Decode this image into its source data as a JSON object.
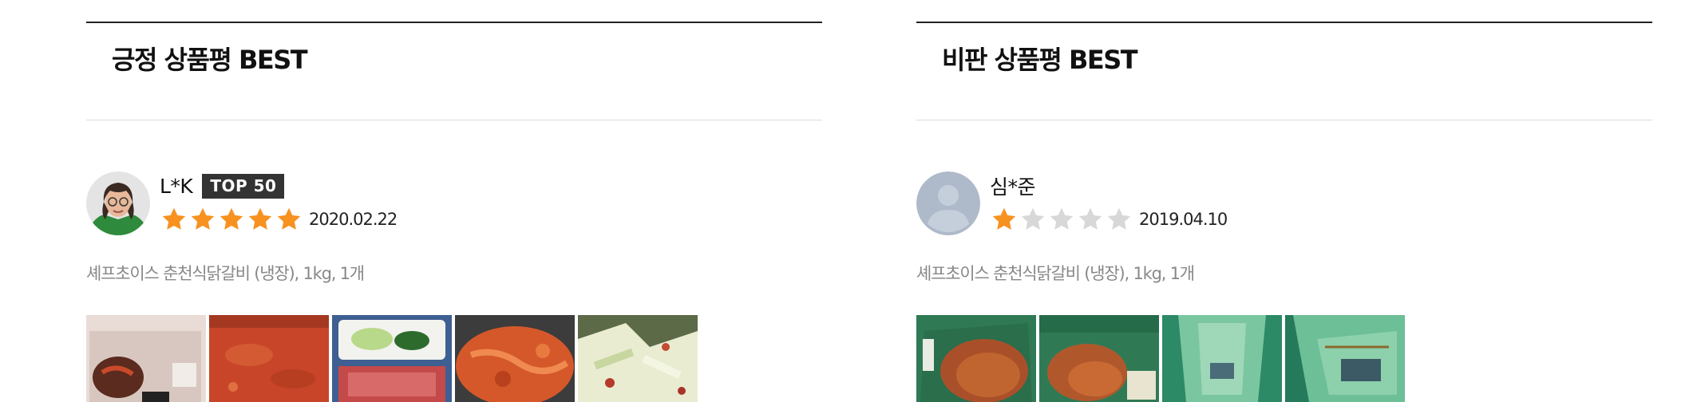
{
  "colors": {
    "star_filled": "#f79220",
    "star_empty": "#d8d8d8",
    "badge_bg": "#333333",
    "rule_dark": "#222222",
    "rule_light": "#dcdcdc",
    "muted_text": "#888888"
  },
  "positive": {
    "title": "긍정 상품평 BEST",
    "review": {
      "avatar": "user-photo",
      "name": "L*K",
      "badge": "TOP 50",
      "rating": 5,
      "max_rating": 5,
      "date": "2020.02.22",
      "product": "셰프초이스 춘천식닭갈비 (냉장), 1kg, 1개",
      "photo_count": 5
    }
  },
  "negative": {
    "title": "비판 상품평 BEST",
    "review": {
      "avatar": "default-user-icon",
      "name": "심*준",
      "rating": 1,
      "max_rating": 5,
      "date": "2019.04.10",
      "product": "셰프초이스 춘천식닭갈비 (냉장), 1kg, 1개",
      "photo_count": 4
    }
  }
}
